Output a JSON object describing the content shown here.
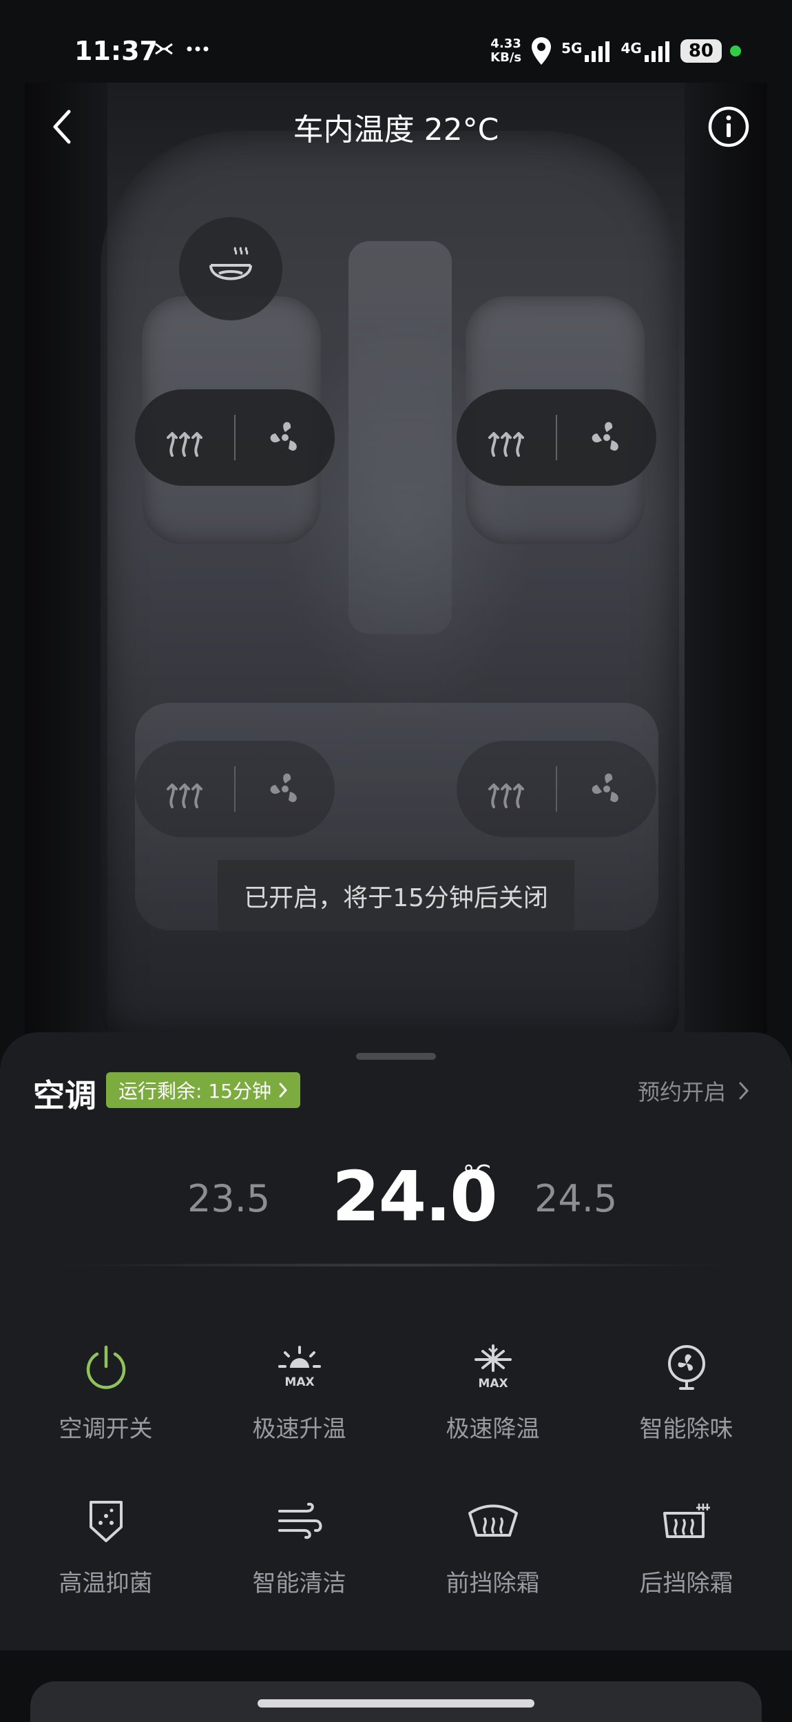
{
  "status_bar": {
    "time": "11:37",
    "speed_value": "4.33",
    "speed_unit": "KB/s",
    "net1": "5G",
    "net2": "4G",
    "battery": "80"
  },
  "nav": {
    "title": "车内温度 22°C"
  },
  "seat_controls": {
    "front_left": [
      "seat-heat-icon",
      "seat-vent-icon"
    ],
    "front_right": [
      "seat-heat-icon",
      "seat-vent-icon"
    ],
    "rear_left": [
      "seat-heat-icon",
      "seat-vent-icon"
    ],
    "rear_right": [
      "seat-heat-icon",
      "seat-vent-icon"
    ]
  },
  "toast": "已开启，将于15分钟后关闭",
  "sheet": {
    "title": "空调",
    "badge": "运行剩余: 15分钟",
    "schedule": "预约开启",
    "temp_left": "23.5",
    "temp_current": "24.0",
    "temp_unit": "°C",
    "temp_right": "24.5",
    "functions": [
      {
        "label": "空调开关",
        "icon": "power-icon"
      },
      {
        "label": "极速升温",
        "icon": "max-heat-icon"
      },
      {
        "label": "极速降温",
        "icon": "max-cool-icon"
      },
      {
        "label": "智能除味",
        "icon": "fan-deodorize-icon"
      },
      {
        "label": "高温抑菌",
        "icon": "sterilize-shield-icon"
      },
      {
        "label": "智能清洁",
        "icon": "wind-clean-icon"
      },
      {
        "label": "前挡除霜",
        "icon": "front-defrost-icon"
      },
      {
        "label": "后挡除霜",
        "icon": "rear-defrost-icon"
      }
    ],
    "max_text": "MAX"
  },
  "colors": {
    "accent_green": "#7cab3f",
    "power_green": "#8fc45a",
    "icon_gray": "#c9cacd"
  }
}
